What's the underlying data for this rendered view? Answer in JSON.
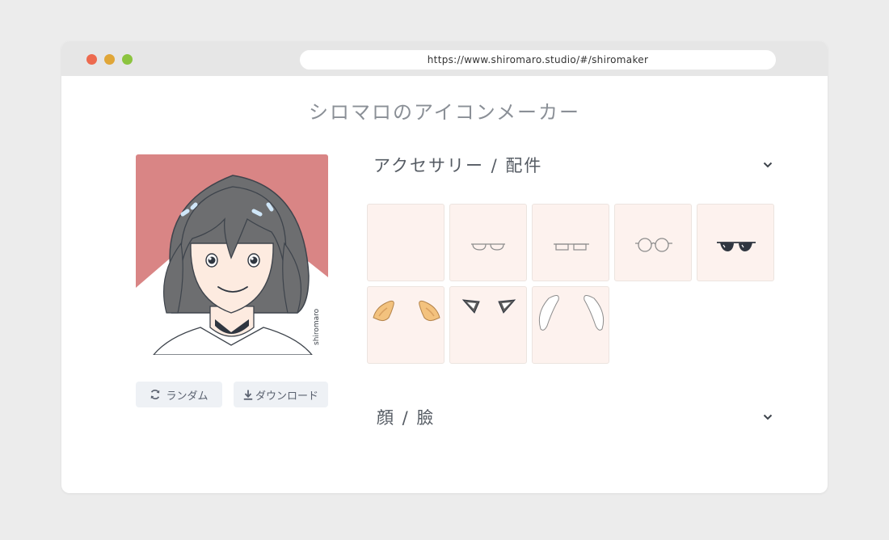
{
  "browser": {
    "url": "https://www.shiromaro.studio/#/shiromaker",
    "traffic_lights": [
      "#ed6a4f",
      "#e0a638",
      "#8cc43f"
    ]
  },
  "app": {
    "title": "シロマロのアイコンメーカー"
  },
  "preview": {
    "background_color": "#d98585",
    "signature": "shiromaro"
  },
  "actions": {
    "random_label": "ランダム",
    "random_icon": "refresh-icon",
    "download_label": "ダウンロード",
    "download_icon": "download-icon"
  },
  "sections": [
    {
      "title": "アクセサリー / 配件",
      "expanded": true,
      "items": [
        {
          "name": "none"
        },
        {
          "name": "half-rim-glasses"
        },
        {
          "name": "rectangle-glasses"
        },
        {
          "name": "round-glasses"
        },
        {
          "name": "sunglasses"
        },
        {
          "name": "dog-ears"
        },
        {
          "name": "cat-ears"
        },
        {
          "name": "bunny-ears"
        }
      ]
    },
    {
      "title": "顔 / 臉",
      "expanded": false
    }
  ],
  "colors": {
    "accent_text": "#555b63",
    "tile_bg": "#fdf2ee",
    "button_bg": "#eef1f5"
  }
}
